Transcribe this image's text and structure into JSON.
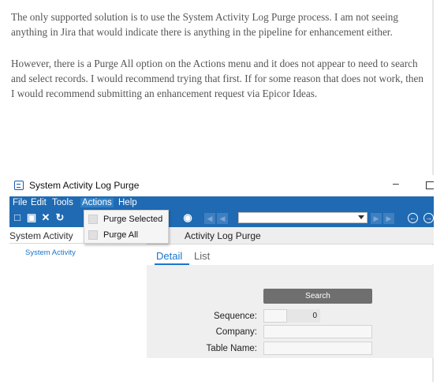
{
  "post": {
    "paragraph1": "The only supported solution is to use the System Activity Log Purge process.  I am not seeing anything in Jira that would indicate there is anything in the pipeline for enhancement either.",
    "paragraph2": "However, there is a Purge All option on the Actions menu and it does not appear to need to search and select records.  I would recommend trying that first.  If for some reason that does not work, then I would recommend submitting an enhancement request via Epicor Ideas."
  },
  "window": {
    "title": "System Activity Log Purge",
    "minimize_glyph": "–"
  },
  "menu": [
    "File",
    "Edit",
    "Tools",
    "Actions",
    "Help"
  ],
  "actions_menu": [
    "Purge Selected",
    "Purge All"
  ],
  "tree": {
    "header": "System Activity",
    "node": "System Activity"
  },
  "main": {
    "title": "Activity Log Purge",
    "tabs": [
      "Detail",
      "List"
    ]
  },
  "form": {
    "search_label": "Search",
    "sequence_label": "Sequence:",
    "sequence_value": "0",
    "company_label": "Company:",
    "table_name_label": "Table Name:"
  },
  "colors": {
    "accent": "#1f6ab3",
    "link": "#1a75cf"
  }
}
